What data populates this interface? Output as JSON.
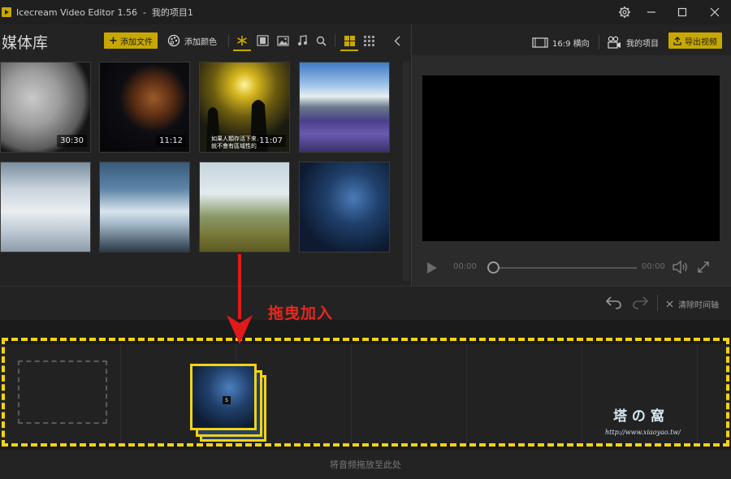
{
  "window": {
    "title": "Icecream Video Editor 1.56  -  我的项目1"
  },
  "library": {
    "title": "媒体库",
    "add_file": "添加文件",
    "add_color": "添加颜色",
    "items": [
      {
        "duration": "30:30"
      },
      {
        "duration": "11:12"
      },
      {
        "duration": "11:07",
        "subtitle_lines": [
          "如果人類存活下來，",
          "就不會有區域性的"
        ]
      },
      {
        "duration": ""
      },
      {
        "duration": ""
      },
      {
        "duration": ""
      },
      {
        "duration": ""
      },
      {
        "duration": ""
      }
    ]
  },
  "preview": {
    "aspect": "16:9 横向",
    "project": "我的项目",
    "export": "导出视频",
    "time_current": "00:00",
    "time_total": "00:00",
    "progress": 0
  },
  "timeline": {
    "clear": "清除时间轴",
    "clip_count_badge": "5",
    "audio_hint": "将音频拖放至此处"
  },
  "annotation": {
    "text": "拖曳加入",
    "color": "#e8271e"
  },
  "watermark": {
    "title": "塔 の 窩",
    "url": "http://www.xiaoyao.tw/"
  },
  "colors": {
    "accent": "#c8a800",
    "drop_zone": "#f2d316"
  }
}
